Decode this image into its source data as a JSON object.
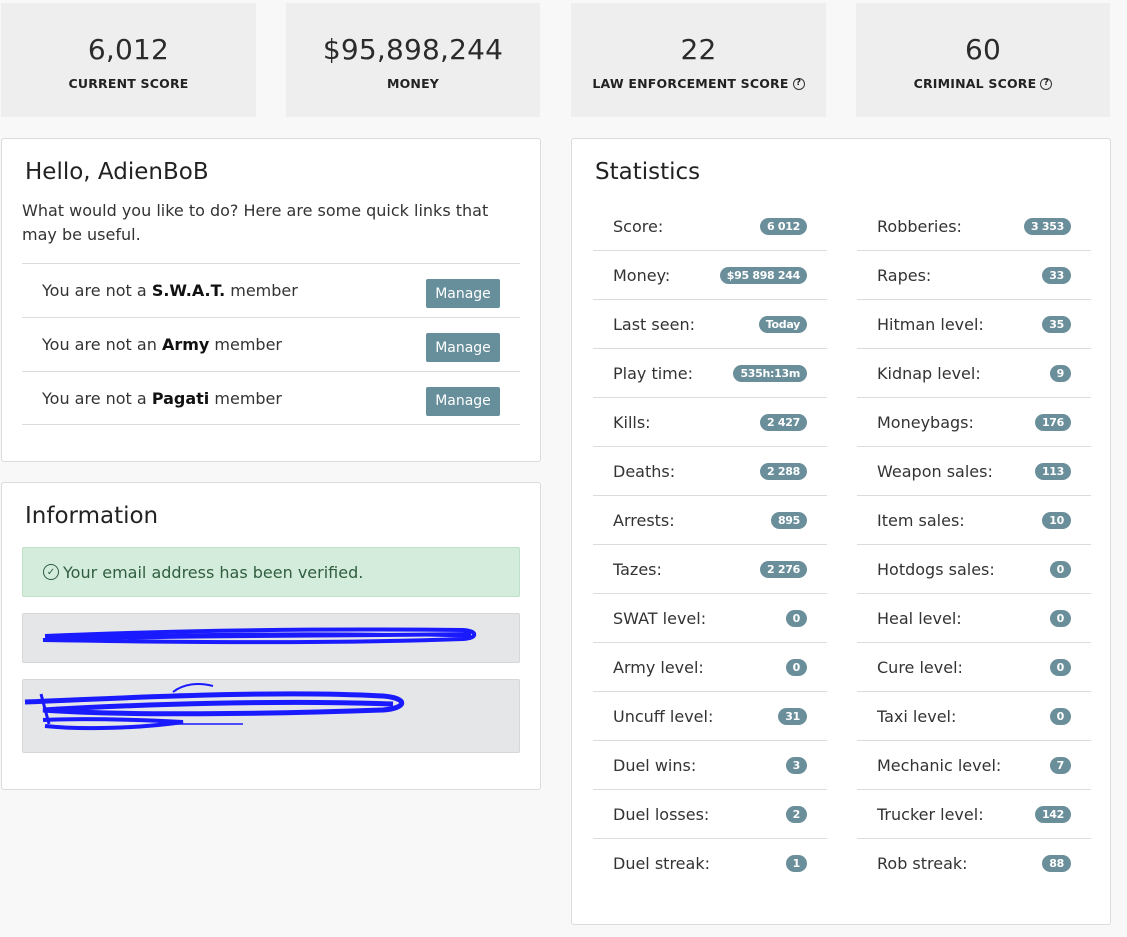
{
  "top_stats": [
    {
      "value": "6,012",
      "label": "CURRENT SCORE",
      "help": false
    },
    {
      "value": "$95,898,244",
      "label": "MONEY",
      "help": false
    },
    {
      "value": "22",
      "label": "LAW ENFORCEMENT SCORE",
      "help": true
    },
    {
      "value": "60",
      "label": "CRIMINAL SCORE",
      "help": true
    }
  ],
  "welcome": {
    "title": "Hello, AdienBoB",
    "intro": "What would you like to do? Here are some quick links that may be useful.",
    "memberships": [
      {
        "prefix": "You are not a ",
        "group": "S.W.A.T.",
        "suffix": " member",
        "button": "Manage"
      },
      {
        "prefix": "You are not an ",
        "group": "Army",
        "suffix": " member",
        "button": "Manage"
      },
      {
        "prefix": "You are not a ",
        "group": "Pagati",
        "suffix": " member",
        "button": "Manage"
      }
    ]
  },
  "information": {
    "title": "Information",
    "email_verified": "Your email address has been verified."
  },
  "statistics": {
    "title": "Statistics",
    "left": [
      {
        "label": "Score:",
        "value": "6 012"
      },
      {
        "label": "Money:",
        "value": "$95 898 244"
      },
      {
        "label": "Last seen:",
        "value": "Today"
      },
      {
        "label": "Play time:",
        "value": "535h:13m"
      },
      {
        "label": "Kills:",
        "value": "2 427"
      },
      {
        "label": "Deaths:",
        "value": "2 288"
      },
      {
        "label": "Arrests:",
        "value": "895"
      },
      {
        "label": "Tazes:",
        "value": "2 276"
      },
      {
        "label": "SWAT level:",
        "value": "0"
      },
      {
        "label": "Army level:",
        "value": "0"
      },
      {
        "label": "Uncuff level:",
        "value": "31"
      },
      {
        "label": "Duel wins:",
        "value": "3"
      },
      {
        "label": "Duel losses:",
        "value": "2"
      },
      {
        "label": "Duel streak:",
        "value": "1"
      }
    ],
    "right": [
      {
        "label": "Robberies:",
        "value": "3 353"
      },
      {
        "label": "Rapes:",
        "value": "33"
      },
      {
        "label": "Hitman level:",
        "value": "35"
      },
      {
        "label": "Kidnap level:",
        "value": "9"
      },
      {
        "label": "Moneybags:",
        "value": "176"
      },
      {
        "label": "Weapon sales:",
        "value": "113"
      },
      {
        "label": "Item sales:",
        "value": "10"
      },
      {
        "label": "Hotdogs sales:",
        "value": "0"
      },
      {
        "label": "Heal level:",
        "value": "0"
      },
      {
        "label": "Cure level:",
        "value": "0"
      },
      {
        "label": "Taxi level:",
        "value": "0"
      },
      {
        "label": "Mechanic level:",
        "value": "7"
      },
      {
        "label": "Trucker level:",
        "value": "142"
      },
      {
        "label": "Rob streak:",
        "value": "88"
      }
    ]
  },
  "colors": {
    "badge": "#6a8f9b",
    "button": "#668e9b",
    "success_bg": "#d4ecdc",
    "scribble": "#1a1aff"
  }
}
